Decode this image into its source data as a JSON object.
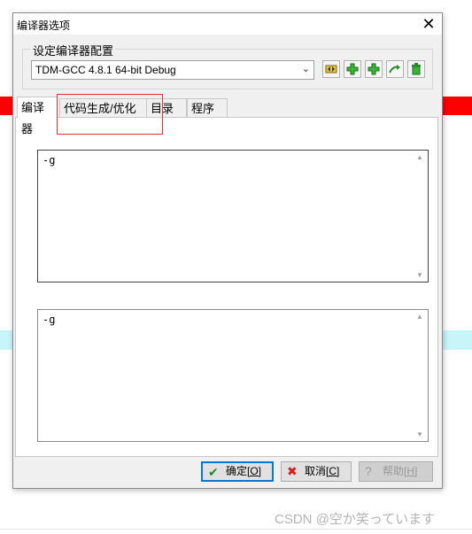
{
  "dialog": {
    "title": "编译器选项",
    "close_symbol": "✕",
    "group_label": "设定编译器配置",
    "config_selected": "TDM-GCC 4.8.1 64-bit Debug",
    "toolbar_icons": [
      "swap-config-icon",
      "add-config-icon",
      "add-config-alt-icon",
      "rename-config-icon",
      "delete-config-icon"
    ],
    "tabs": [
      {
        "label": "编译器"
      },
      {
        "label": "代码生成/优化"
      },
      {
        "label": "目录"
      },
      {
        "label": "程序"
      }
    ],
    "compiler_commands": "-g",
    "linker_commands": "-g",
    "buttons": {
      "ok_label": "确定",
      "ok_shortcut": "[O]",
      "cancel_label": "取消",
      "cancel_shortcut": "[C]",
      "help_label": "帮助",
      "help_shortcut": "[H]"
    }
  },
  "watermark": "CSDN @空か笑っています",
  "colors": {
    "accent": "#0078d7",
    "annotation": "#e03030",
    "highlight_red": "#ff0000",
    "highlight_cyan": "#c8f5fa"
  }
}
